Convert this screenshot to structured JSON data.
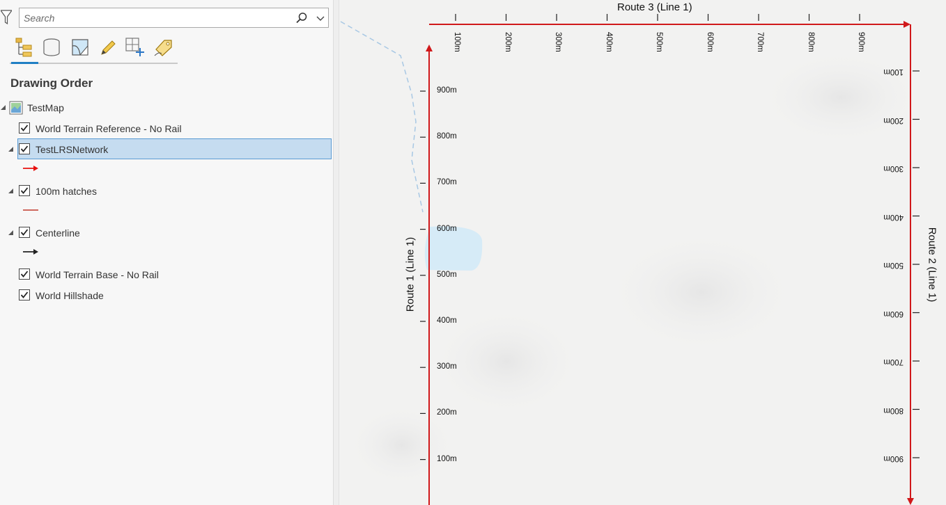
{
  "contents": {
    "search": {
      "placeholder": "Search",
      "value": ""
    },
    "toolbar": [
      "drawing-order",
      "data-source",
      "selection",
      "editing",
      "snapping",
      "labeling"
    ],
    "title": "Drawing Order",
    "layers": {
      "map": {
        "label": "TestMap",
        "expanded": true
      },
      "terrain_reference": {
        "label": "World Terrain Reference - No Rail",
        "checked": true
      },
      "lrs_network": {
        "label": "TestLRSNetwork",
        "checked": true,
        "expanded": true,
        "selected": true,
        "symbol_color": "#e8110f"
      },
      "hatches": {
        "label": "100m hatches",
        "checked": true,
        "expanded": true,
        "symbol_color": "#c0392b"
      },
      "centerline": {
        "label": "Centerline",
        "checked": true,
        "expanded": true,
        "symbol_color": "#222222"
      },
      "terrain_base": {
        "label": "World Terrain Base - No Rail",
        "checked": true
      },
      "hillshade": {
        "label": "World Hillshade",
        "checked": true
      }
    }
  },
  "map": {
    "route_color": "#d0181a",
    "water_color": "#d6ebf7",
    "routes": {
      "top": "Route 3 (Line 1)",
      "left": "Route 1 (Line 1)",
      "right": "Route 2 (Line 1)"
    },
    "top_ticks": [
      "100m",
      "200m",
      "300m",
      "400m",
      "500m",
      "600m",
      "700m",
      "800m",
      "900m"
    ],
    "left_ticks": [
      "900m",
      "800m",
      "700m",
      "600m",
      "500m",
      "400m",
      "300m",
      "200m",
      "100m"
    ],
    "right_ticks": [
      "100m",
      "200m",
      "300m",
      "400m",
      "500m",
      "600m",
      "700m",
      "800m",
      "900m"
    ]
  }
}
